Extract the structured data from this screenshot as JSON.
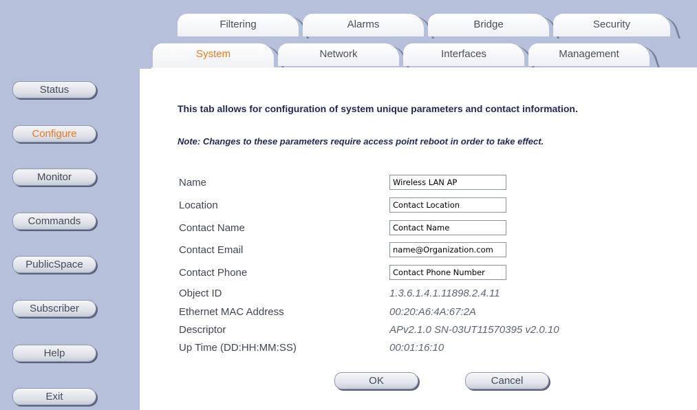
{
  "sidebar": {
    "items": [
      {
        "label": "Status"
      },
      {
        "label": "Configure"
      },
      {
        "label": "Monitor"
      },
      {
        "label": "Commands"
      },
      {
        "label": "PublicSpace"
      },
      {
        "label": "Subscriber"
      },
      {
        "label": "Help"
      },
      {
        "label": "Exit"
      }
    ]
  },
  "tabs": {
    "back": [
      {
        "label": "Filtering"
      },
      {
        "label": "Alarms"
      },
      {
        "label": "Bridge"
      },
      {
        "label": "Security"
      }
    ],
    "front": [
      {
        "label": "System"
      },
      {
        "label": "Network"
      },
      {
        "label": "Interfaces"
      },
      {
        "label": "Management"
      }
    ]
  },
  "main": {
    "intro": "This tab allows for configuration of system unique parameters and contact information.",
    "note": "Note: Changes to these parameters require access point reboot in order to take effect.",
    "fields": {
      "name": {
        "label": "Name",
        "value": "Wireless LAN AP"
      },
      "location": {
        "label": "Location",
        "value": "Contact Location"
      },
      "contact_name": {
        "label": "Contact Name",
        "value": "Contact Name"
      },
      "contact_email": {
        "label": "Contact Email",
        "value": "name@Organization.com"
      },
      "contact_phone": {
        "label": "Contact Phone",
        "value": "Contact Phone Number"
      }
    },
    "info": {
      "object_id": {
        "label": "Object ID",
        "value": "1.3.6.1.4.1.11898.2.4.11"
      },
      "mac": {
        "label": "Ethernet MAC Address",
        "value": "00:20:A6:4A:67:2A"
      },
      "descriptor": {
        "label": "Descriptor",
        "value": "APv2.1.0 SN-03UT11570395 v2.0.10"
      },
      "uptime": {
        "label": "Up Time (DD:HH:MM:SS)",
        "value": "00:01:16:10"
      }
    },
    "buttons": {
      "ok": "OK",
      "cancel": "Cancel"
    }
  },
  "colors": {
    "sidebar_bg": "#b7c0da",
    "active_orange": "#f07a1a",
    "heading_navy": "#1c2a55"
  }
}
